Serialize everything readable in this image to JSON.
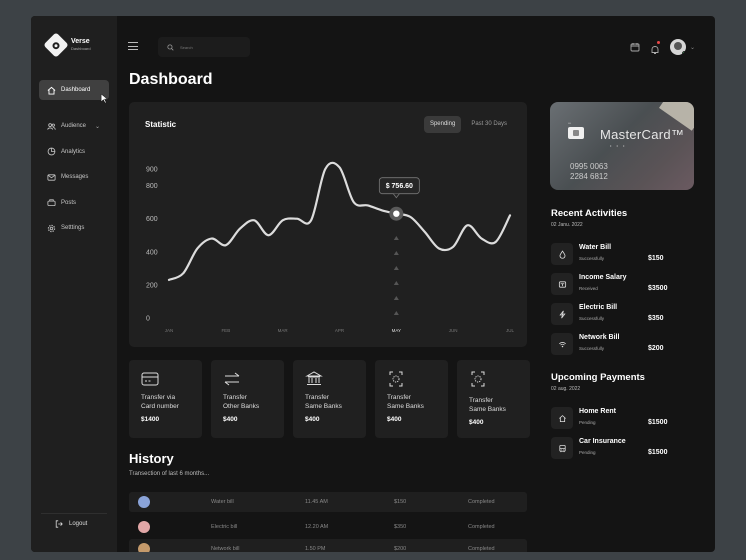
{
  "brand": {
    "name": "Verse",
    "sub": "Dashboard"
  },
  "sidebar": {
    "items": [
      {
        "label": "Dashboard"
      },
      {
        "label": "Audience"
      },
      {
        "label": "Analytics"
      },
      {
        "label": "Messages"
      },
      {
        "label": "Posts"
      },
      {
        "label": "Setttings"
      }
    ],
    "logout": "Logout"
  },
  "search": {
    "placeholder": "Search"
  },
  "page": {
    "title": "Dashboard"
  },
  "statistic": {
    "title": "Statistic",
    "tabs": [
      "Spending",
      "Past 30 Days"
    ],
    "tooltip": "$ 756.60"
  },
  "chart_data": {
    "type": "line",
    "title": "Statistic",
    "categories": [
      "JAN",
      "FEB",
      "MAR",
      "APR",
      "MAY",
      "JUN",
      "JUL"
    ],
    "yticks": [
      0,
      200,
      400,
      600,
      800,
      900
    ],
    "ylim": [
      0,
      900
    ],
    "series": [
      {
        "x": [
          0,
          0.25,
          0.5,
          0.75,
          1,
          1.25,
          1.5,
          1.75,
          2,
          2.25,
          2.5,
          2.75,
          3,
          3.25,
          3.5,
          3.75,
          4,
          4.25,
          4.5,
          4.75,
          5,
          5.25,
          5.5,
          5.75,
          6
        ],
        "values": [
          230,
          270,
          420,
          480,
          440,
          540,
          590,
          500,
          590,
          600,
          590,
          900,
          910,
          700,
          680,
          650,
          630,
          610,
          520,
          420,
          430,
          560,
          480,
          460,
          620
        ]
      }
    ],
    "highlight": {
      "category": "MAY",
      "label": "$ 756.60"
    },
    "grid": false
  },
  "transfers": [
    {
      "label": "Transfer via\nCard number",
      "amount": "$1400",
      "icon": "card-icon"
    },
    {
      "label": "Transfer\nOther Banks",
      "amount": "$400",
      "icon": "arrows-exchange-icon"
    },
    {
      "label": "Transfer\nSame Banks",
      "amount": "$400",
      "icon": "bank-icon"
    },
    {
      "label": "Transfer\nSame Banks",
      "amount": "$400",
      "icon": "scan-icon"
    },
    {
      "label": "Transfer\nSame Banks",
      "amount": "$400",
      "icon": "scan-icon"
    }
  ],
  "history": {
    "title": "History",
    "subtitle": "Transection of last 6 months...",
    "rows": [
      {
        "name": "Water bill",
        "time": "11.45 AM",
        "amount": "$150",
        "status": "Completed",
        "avatar_color": "#8aa3d8"
      },
      {
        "name": "Electric bill",
        "time": "12.20 AM",
        "amount": "$350",
        "status": "Completed",
        "avatar_color": "#e2a7a7"
      },
      {
        "name": "Network bill",
        "time": "1.50 PM",
        "amount": "$200",
        "status": "Completed",
        "avatar_color": "#c49a6b"
      }
    ]
  },
  "card": {
    "brand": "MasterCard™",
    "small": "•••",
    "dots": "• • •",
    "number_line1": "0995 0063",
    "number_line2": "2284 6812"
  },
  "recent": {
    "title": "Recent Activities",
    "date": "02 Janu. 2022",
    "items": [
      {
        "name": "Water Bill",
        "status": "Successfully",
        "amount": "$150",
        "icon": "droplet-icon"
      },
      {
        "name": "Income Salary",
        "status": "Received",
        "amount": "$3500",
        "icon": "wallet-icon"
      },
      {
        "name": "Electric Bill",
        "status": "Successfully",
        "amount": "$350",
        "icon": "lightning-icon"
      },
      {
        "name": "Network Bill",
        "status": "Successfully",
        "amount": "$200",
        "icon": "wifi-icon"
      }
    ]
  },
  "upcoming": {
    "title": "Upcoming Payments",
    "date": "02 aug. 2022",
    "items": [
      {
        "name": "Home Rent",
        "status": "Pending",
        "amount": "$1500",
        "icon": "home-icon"
      },
      {
        "name": "Car Insurance",
        "status": "Pending",
        "amount": "$1500",
        "icon": "car-icon"
      }
    ]
  },
  "colors": {
    "background": "#141414",
    "panel": "#202020",
    "accent": "#ffffff",
    "online": "#3ecf6e",
    "notify": "#e84747"
  }
}
